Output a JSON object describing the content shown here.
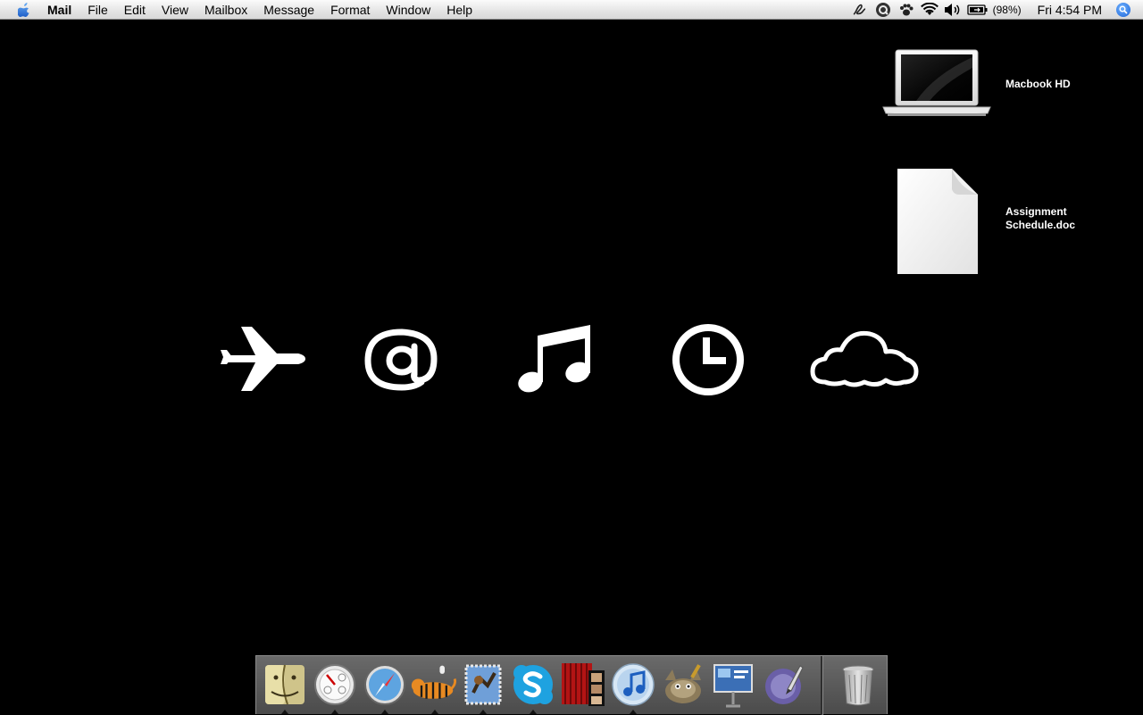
{
  "menubar": {
    "app_name": "Mail",
    "menus": [
      "File",
      "Edit",
      "View",
      "Mailbox",
      "Message",
      "Format",
      "Window",
      "Help"
    ],
    "status_icons": [
      "script-icon",
      "quicksilver-icon",
      "growl-paw-icon",
      "wifi-icon",
      "volume-icon",
      "battery-icon"
    ],
    "battery_percent": "(98%)",
    "clock": "Fri 4:54 PM"
  },
  "desktop": {
    "items": [
      {
        "label": "Macbook HD",
        "icon": "laptop-icon"
      },
      {
        "label": "Assignment\nSchedule.doc",
        "icon": "document-icon"
      }
    ]
  },
  "glyphs": [
    "airplane-icon",
    "at-sign-icon",
    "music-note-icon",
    "clock-icon",
    "cloud-icon"
  ],
  "dock": {
    "apps": [
      {
        "name": "finder-icon",
        "running": true
      },
      {
        "name": "dashboard-icon",
        "running": true
      },
      {
        "name": "safari-icon",
        "running": true
      },
      {
        "name": "tiger-icon",
        "running": true
      },
      {
        "name": "mail-icon",
        "running": true
      },
      {
        "name": "skype-icon",
        "running": true
      },
      {
        "name": "photo-booth-icon",
        "running": false
      },
      {
        "name": "itunes-icon",
        "running": true
      },
      {
        "name": "gimp-icon",
        "running": false
      },
      {
        "name": "keynote-icon",
        "running": false
      },
      {
        "name": "script-editor-icon",
        "running": false
      }
    ],
    "trash": "trash-icon"
  }
}
